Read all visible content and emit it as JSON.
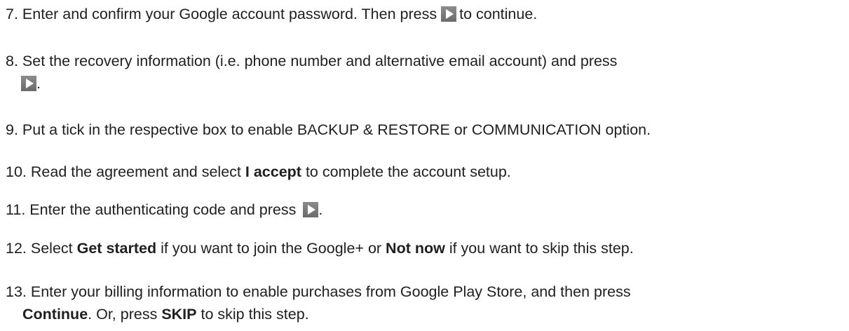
{
  "steps": [
    {
      "num": "7.",
      "pre": "Enter and confirm your Google account password. Then press",
      "icon": "play-icon",
      "post": "to continue."
    },
    {
      "num": "8.",
      "pre": "Set the recovery information (i.e. phone number and alternative email account) and press",
      "icon": "play-icon",
      "post": "."
    },
    {
      "num": "9.",
      "text": "Put a tick in the respective box to enable BACKUP & RESTORE or COMMUNICATION option."
    },
    {
      "num": "10.",
      "pre": "Read the agreement and select",
      "bold": "I accept",
      "post": "to complete the account setup."
    },
    {
      "num": "11.",
      "pre": "Enter the authenticating code and press",
      "icon": "play-icon",
      "post": "."
    },
    {
      "num": "12.",
      "pre": "Select",
      "bold1": "Get started",
      "mid": "if you want to join the Google+ or",
      "bold2": "Not now",
      "post": "if you want to skip this step."
    },
    {
      "num": "13.",
      "line1": "Enter your billing information to enable purchases from Google Play Store, and then press",
      "bold1": "Continue",
      "mid": ". Or, press",
      "bold2": "SKIP",
      "post": "to skip this step."
    }
  ]
}
